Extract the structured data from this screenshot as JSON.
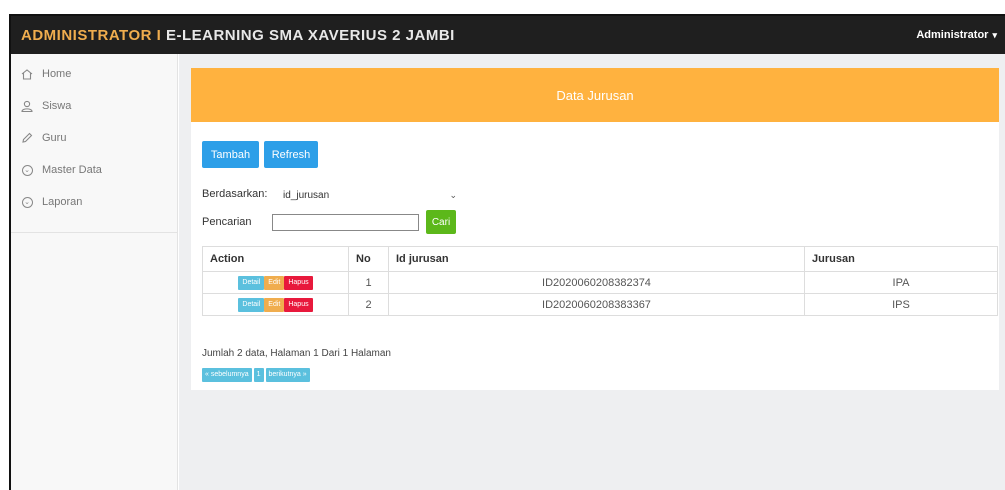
{
  "header": {
    "brand_accent": "ADMINISTRATOR I",
    "brand_rest": "E-LEARNING SMA XAVERIUS 2 JAMBI",
    "user_label": "Administrator",
    "user_caret": "▾"
  },
  "sidebar": {
    "items": [
      {
        "label": "Home",
        "icon": "home-icon"
      },
      {
        "label": "Siswa",
        "icon": "user-icon"
      },
      {
        "label": "Guru",
        "icon": "pencil-icon"
      },
      {
        "label": "Master Data",
        "icon": "chevron-circle-icon"
      },
      {
        "label": "Laporan",
        "icon": "chevron-circle-icon"
      }
    ]
  },
  "panel": {
    "title": "Data Jurusan",
    "tambah_label": "Tambah",
    "refresh_label": "Refresh",
    "filter_label": "Berdasarkan:",
    "filter_selected": "id_jurusan",
    "search_label": "Pencarian",
    "search_value": "",
    "cari_label": "Cari"
  },
  "table": {
    "headers": [
      "Action",
      "No",
      "Id jurusan",
      "Jurusan"
    ],
    "action_labels": {
      "detail": "Detail",
      "edit": "Edit",
      "hapus": "Hapus"
    },
    "rows": [
      {
        "no": "1",
        "id": "ID2020060208382374",
        "jurusan": "IPA"
      },
      {
        "no": "2",
        "id": "ID2020060208383367",
        "jurusan": "IPS"
      }
    ]
  },
  "footer": {
    "summary": "Jumlah 2 data, Halaman 1 Dari 1 Halaman",
    "prev_label": "« sebelumnya",
    "page_label": "1",
    "next_label": "berikutnya »"
  },
  "colors": {
    "topbar": "#1f1f1f",
    "brand_accent": "#f0ad4e",
    "panel_heading": "#ffb23f",
    "primary": "#2d9fe8",
    "success": "#5cb81a",
    "info": "#5bc0de",
    "danger": "#e8193c"
  }
}
